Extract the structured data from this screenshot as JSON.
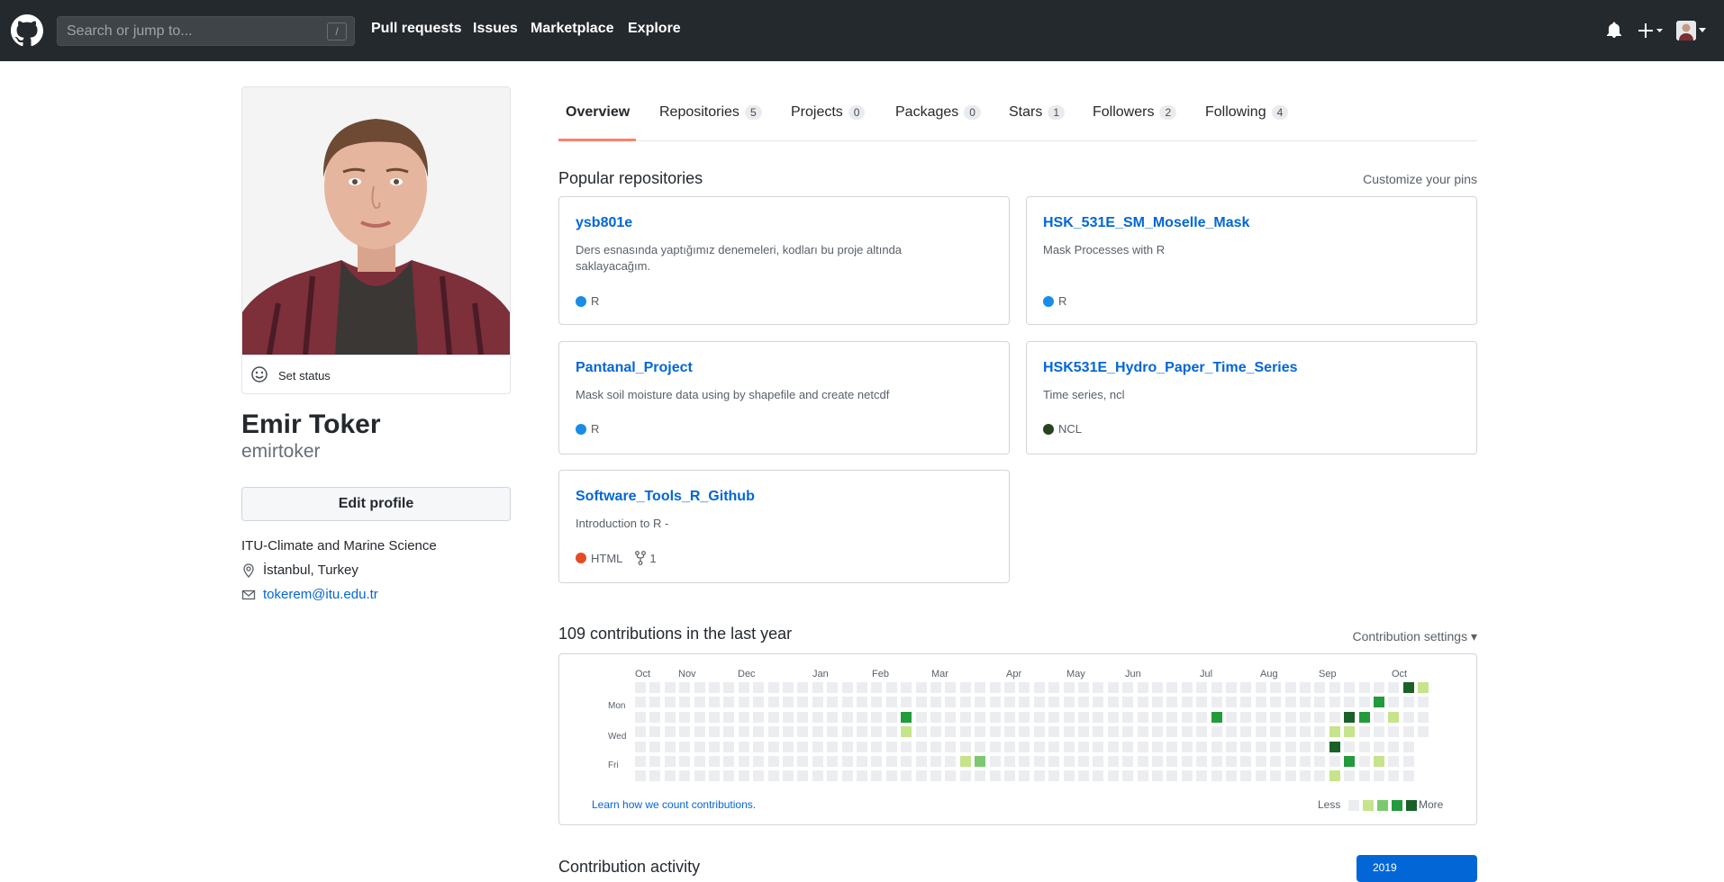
{
  "header": {
    "search_placeholder": "Search or jump to...",
    "search_shortcut": "/",
    "nav": [
      "Pull requests",
      "Issues",
      "Marketplace",
      "Explore"
    ]
  },
  "profile": {
    "set_status": "Set status",
    "full_name": "Emir Toker",
    "username": "emirtoker",
    "edit_profile": "Edit profile",
    "organization": "ITU-Climate and Marine Science",
    "location": "İstanbul, Turkey",
    "email": "tokerem@itu.edu.tr"
  },
  "tabs": [
    {
      "label": "Overview",
      "count": ""
    },
    {
      "label": "Repositories",
      "count": "5"
    },
    {
      "label": "Projects",
      "count": "0"
    },
    {
      "label": "Packages",
      "count": "0"
    },
    {
      "label": "Stars",
      "count": "1"
    },
    {
      "label": "Followers",
      "count": "2"
    },
    {
      "label": "Following",
      "count": "4"
    }
  ],
  "pinned": {
    "title": "Popular repositories",
    "customize": "Customize your pins",
    "repos": [
      {
        "name": "ysb801e",
        "description": "Ders esnasında yaptığımız denemeleri, kodları bu proje altında saklayacağım.",
        "language": "R",
        "lang_color": "#198CE7",
        "forks": ""
      },
      {
        "name": "HSK_531E_SM_Moselle_Mask",
        "description": "Mask Processes with R",
        "language": "R",
        "lang_color": "#198CE7",
        "forks": ""
      },
      {
        "name": "Pantanal_Project",
        "description": "Mask soil moisture data using by shapefile and create netcdf",
        "language": "R",
        "lang_color": "#198CE7",
        "forks": ""
      },
      {
        "name": "HSK531E_Hydro_Paper_Time_Series",
        "description": "Time series, ncl",
        "language": "NCL",
        "lang_color": "#28431f",
        "forks": ""
      },
      {
        "name": "Software_Tools_R_Github",
        "description": "Introduction to R -",
        "language": "HTML",
        "lang_color": "#e34c26",
        "forks": "1"
      }
    ]
  },
  "contributions": {
    "title": "109 contributions in the last year",
    "settings": "Contribution settings ▾",
    "months": [
      "Oct",
      "Nov",
      "Dec",
      "Jan",
      "Feb",
      "Mar",
      "Apr",
      "May",
      "Jun",
      "Jul",
      "Aug",
      "Sep",
      "Oct"
    ],
    "days": [
      "Mon",
      "Wed",
      "Fri"
    ],
    "learn": "Learn how we count contributions.",
    "less": "Less",
    "more": "More",
    "level_colors": [
      "#ebedf0",
      "#c6e48b",
      "#7bc96f",
      "#239a3b",
      "#196127"
    ]
  },
  "activity": {
    "title": "Contribution activity",
    "year": "2019"
  }
}
